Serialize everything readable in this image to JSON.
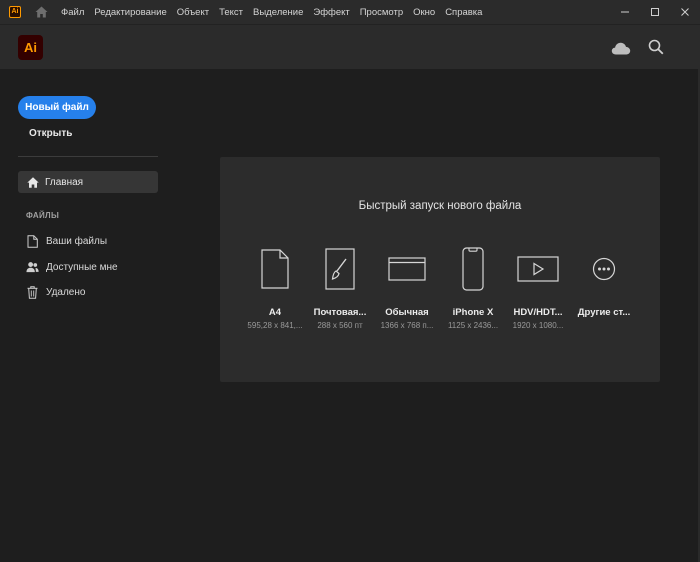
{
  "titlebar": {
    "app_icon": "Ai",
    "menu": [
      "Файл",
      "Редактирование",
      "Объект",
      "Текст",
      "Выделение",
      "Эффект",
      "Просмотр",
      "Окно",
      "Справка"
    ]
  },
  "header": {
    "logo": "Ai",
    "cloud_icon": "cloud-icon",
    "search_icon": "search-icon"
  },
  "sidebar": {
    "new_file": "Новый файл",
    "open": "Открыть",
    "home": "Главная",
    "section": "ФАЙЛЫ",
    "items": [
      {
        "label": "Ваши файлы",
        "icon": "document-icon"
      },
      {
        "label": "Доступные мне",
        "icon": "shared-users-icon"
      },
      {
        "label": "Удалено",
        "icon": "trash-icon"
      }
    ]
  },
  "quickstart": {
    "title": "Быстрый запуск нового файла",
    "presets": [
      {
        "name": "A4",
        "dims": "595,28 x 841,...",
        "icon": "page-icon"
      },
      {
        "name": "Почтовая...",
        "dims": "288 x 560 пт",
        "icon": "brush-card-icon"
      },
      {
        "name": "Обычная",
        "dims": "1366 x 768 п...",
        "icon": "browser-window-icon"
      },
      {
        "name": "iPhone X",
        "dims": "1125 x 2436...",
        "icon": "phone-icon"
      },
      {
        "name": "HDV/HDT...",
        "dims": "1920 x 1080...",
        "icon": "video-icon"
      },
      {
        "name": "Другие ст...",
        "dims": "",
        "icon": "more-icon"
      }
    ]
  },
  "colors": {
    "accent": "#2680eb",
    "brand": "#ff9a00"
  }
}
